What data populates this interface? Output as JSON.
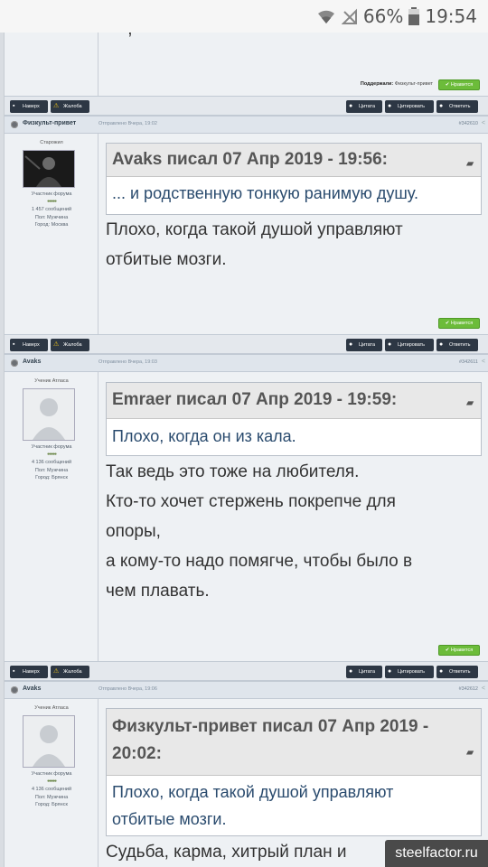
{
  "statusbar": {
    "battery": "66%",
    "time": "19:54"
  },
  "post0": {
    "thanks_label": "Поддержали:",
    "thanks_users": "Физкульт-привет",
    "like_label": "Нравится"
  },
  "bar_labels": {
    "top": "Наверх",
    "report": "Жалоба",
    "quote": "Цитата",
    "multiquote": "Цитировать",
    "reply": "Ответить"
  },
  "posts": [
    {
      "author": "Физкульт-привет",
      "date": "Отправлено Вчера, 19:02",
      "num": "#342610",
      "rank": "Старожил",
      "group": "Участник форума",
      "stars": "●●●●●",
      "count": "1 457 сообщений",
      "sex": "Пол: Мужчина",
      "city": "Город: Москва",
      "quote_header": "Avaks писал 07 Апр 2019 - 19:56:",
      "quote_body": "... и  родственную тонкую ранимую душу.",
      "text_lines": [
        "Плохо, когда такой душой управляют",
        "отбитые мозги."
      ],
      "like": "Нравится"
    },
    {
      "author": "Avaks",
      "date": "Отправлено Вчера, 19:03",
      "num": "#342611",
      "rank": "Ученик Атласа",
      "group": "Участник форума",
      "stars": "●●●●●",
      "count": "4 136 сообщений",
      "sex": "Пол: Мужчина",
      "city": "Город: Брянск",
      "quote_header": "Emraer писал 07 Апр 2019 - 19:59:",
      "quote_body": "Плохо, когда он из кала.",
      "text_lines": [
        "Так ведь это тоже на любителя.",
        "Кто-то хочет стержень покрепче для",
        "опоры,",
        "а кому-то надо помягче, чтобы было в",
        "чем плавать."
      ],
      "like": "Нравится"
    },
    {
      "author": "Avaks",
      "date": "Отправлено Вчера, 19:06",
      "num": "#342612",
      "rank": "Ученик Атласа",
      "group": "Участник форума",
      "stars": "●●●●●",
      "count": "4 136 сообщений",
      "sex": "Пол: Мужчина",
      "city": "Город: Брянск",
      "quote_header_lines": [
        "Физкульт-привет писал 07 Апр 2019 -",
        "20:02:"
      ],
      "quote_body_lines": [
        "Плохо, когда такой душой управляют",
        "отбитые мозги."
      ],
      "text_lines": [
        "Судьба, карма, хитрый план и"
      ]
    }
  ],
  "watermark": "steelfactor.ru"
}
